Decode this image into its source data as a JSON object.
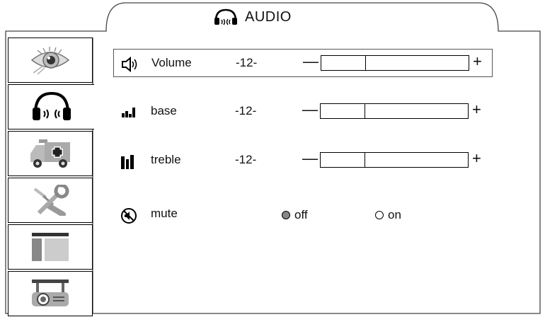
{
  "header": {
    "title": "AUDIO",
    "icon": "headphones-icon"
  },
  "sidebar": {
    "items": [
      {
        "name": "display",
        "icon": "eye-icon"
      },
      {
        "name": "audio",
        "icon": "headphones-icon",
        "active": true
      },
      {
        "name": "emergency",
        "icon": "ambulance-icon"
      },
      {
        "name": "tools",
        "icon": "wrench-icon"
      },
      {
        "name": "layout",
        "icon": "window-layout-icon"
      },
      {
        "name": "projector",
        "icon": "projector-icon"
      }
    ]
  },
  "settings": {
    "volume": {
      "label": "Volume",
      "value": "-12-",
      "minus": "—",
      "plus": "+",
      "level": 0.3
    },
    "base": {
      "label": "base",
      "value": "-12-",
      "minus": "—",
      "plus": "+",
      "level": 0.3
    },
    "treble": {
      "label": "treble",
      "value": "-12-",
      "minus": "—",
      "plus": "+",
      "level": 0.3
    },
    "mute": {
      "label": "mute",
      "off_label": "off",
      "on_label": "on",
      "selected": "off"
    }
  }
}
